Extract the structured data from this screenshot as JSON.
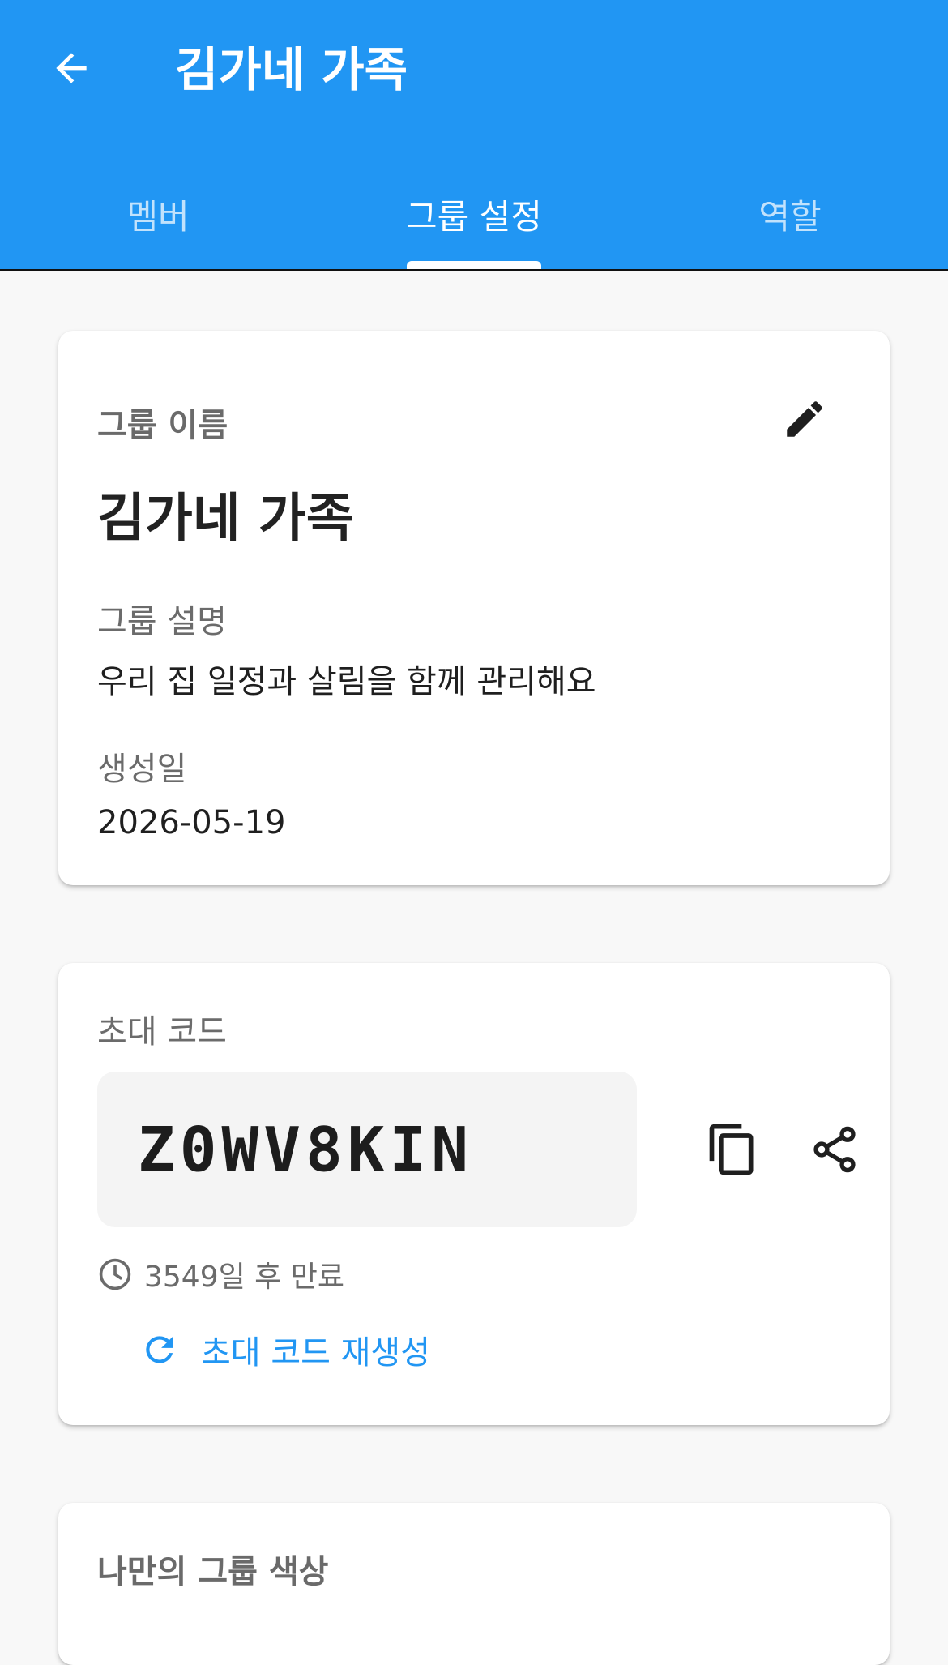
{
  "appbar": {
    "title": "김가네 가족",
    "back_icon": "arrow-back-icon"
  },
  "tabs": [
    {
      "label": "멤버",
      "active": false
    },
    {
      "label": "그룹 설정",
      "active": true
    },
    {
      "label": "역할",
      "active": false
    }
  ],
  "group_info": {
    "name_label": "그룹 이름",
    "name": "김가네 가족",
    "edit_icon": "pencil-icon",
    "description_label": "그룹 설명",
    "description": "우리 집 일정과 살림을 함께 관리해요",
    "created_label": "생성일",
    "created_date": "2026-05-19"
  },
  "invite": {
    "label": "초대 코드",
    "code": "Z0WV8KIN",
    "copy_icon": "copy-icon",
    "share_icon": "share-icon",
    "expiry_icon": "clock-icon",
    "expiry_text": "3549일 후 만료",
    "regenerate_icon": "refresh-icon",
    "regenerate_label": "초대 코드 재생성"
  },
  "color_section": {
    "label": "나만의 그룹 색상"
  },
  "colors": {
    "primary": "#2196f3",
    "background": "#f8f8f8",
    "card": "#ffffff"
  }
}
